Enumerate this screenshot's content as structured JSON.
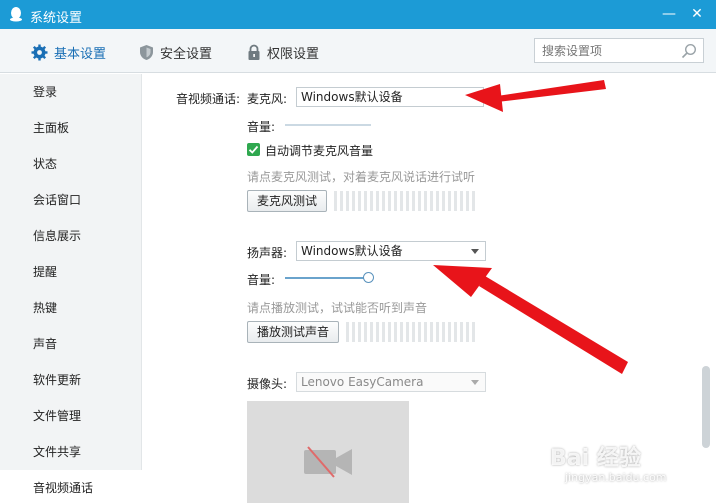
{
  "window": {
    "title": "系统设置",
    "minimize_symbol": "—",
    "close_symbol": "✕"
  },
  "tabs": [
    {
      "label": "基本设置",
      "icon": "gear-icon",
      "active": true
    },
    {
      "label": "安全设置",
      "icon": "shield-icon",
      "active": false
    },
    {
      "label": "权限设置",
      "icon": "lock-icon",
      "active": false
    }
  ],
  "search": {
    "placeholder": "搜索设置项"
  },
  "sidebar": {
    "items": [
      {
        "label": "登录"
      },
      {
        "label": "主面板"
      },
      {
        "label": "状态"
      },
      {
        "label": "会话窗口"
      },
      {
        "label": "信息展示"
      },
      {
        "label": "提醒"
      },
      {
        "label": "热键"
      },
      {
        "label": "声音"
      },
      {
        "label": "软件更新"
      },
      {
        "label": "文件管理"
      },
      {
        "label": "文件共享"
      },
      {
        "label": "音视频通话"
      }
    ],
    "active_index": 11
  },
  "section": {
    "title": "音视频通话:"
  },
  "microphone": {
    "label": "麦克风:",
    "device": "Windows默认设备",
    "volume_label": "音量:",
    "auto_adjust_label": "自动调节麦克风音量",
    "auto_adjust_checked": true,
    "hint": "请点麦克风测试，对着麦克风说话进行试听",
    "test_button": "麦克风测试"
  },
  "speaker": {
    "label": "扬声器:",
    "device": "Windows默认设备",
    "volume_label": "音量:",
    "volume_fraction": 1.0,
    "hint": "请点播放测试，试试能否听到声音",
    "test_button": "播放测试声音"
  },
  "camera": {
    "label": "摄像头:",
    "device": "Lenovo EasyCamera"
  },
  "watermark": {
    "text": "Bai 经验",
    "url_text": "jingyan.baidu.com"
  },
  "colors": {
    "titlebar": "#1c9bd6",
    "accent": "#1a6fb5",
    "arrow": "#e8141a",
    "check": "#2fa84f"
  }
}
